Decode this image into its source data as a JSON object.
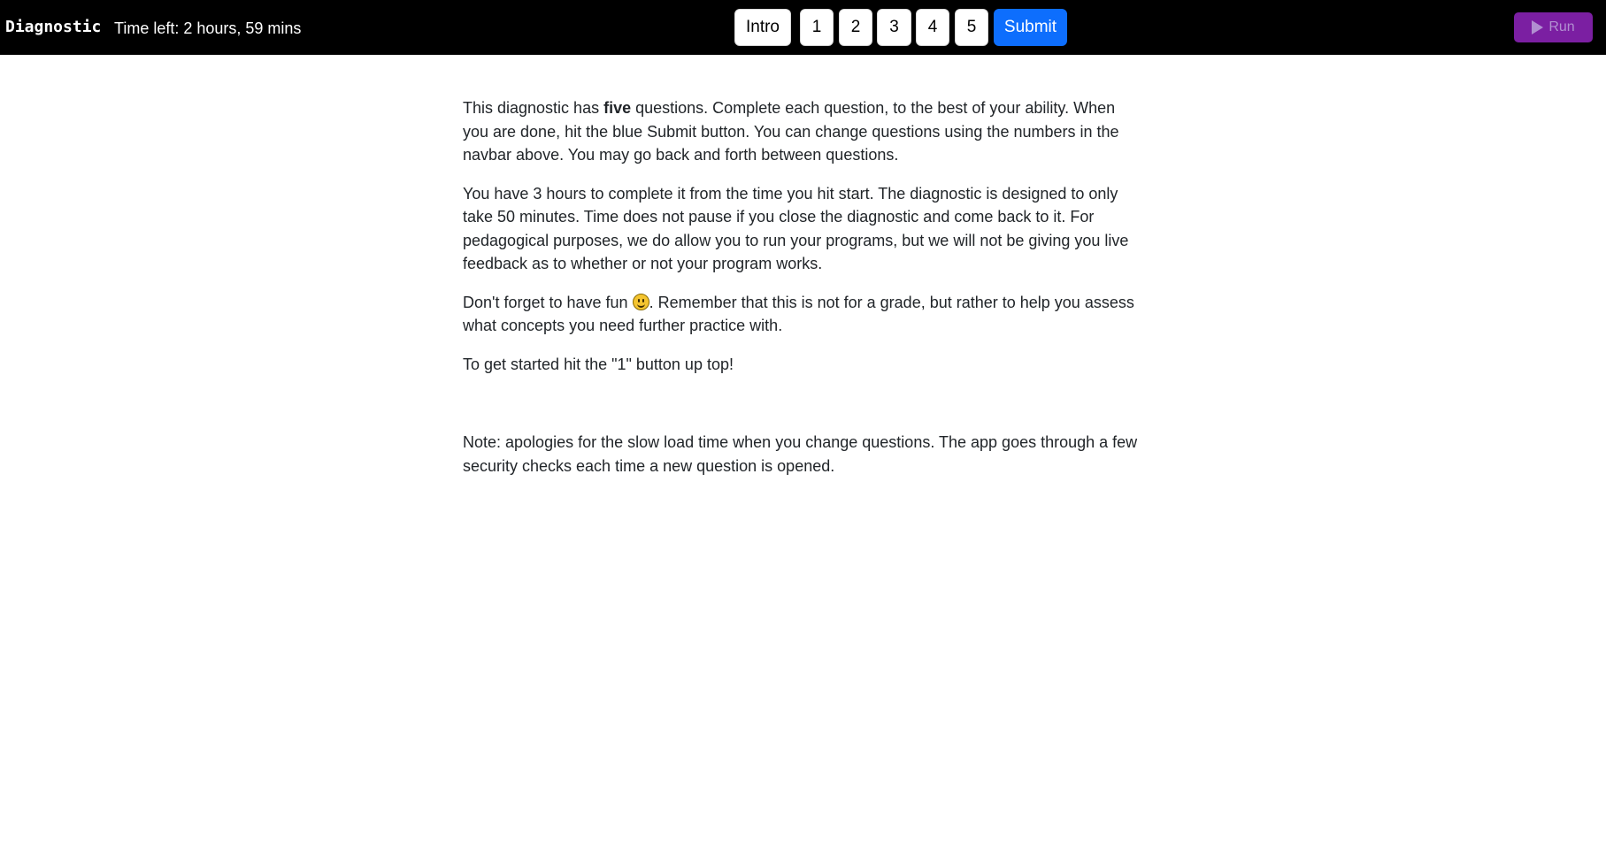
{
  "navbar": {
    "brand": "Diagnostic",
    "timer": "Time left: 2 hours, 59 mins",
    "intro_label": "Intro",
    "questions": [
      "1",
      "2",
      "3",
      "4",
      "5"
    ],
    "submit_label": "Submit",
    "run_label": "Run",
    "run_icon": "play-icon"
  },
  "content": {
    "p1_before": "This diagnostic has ",
    "p1_bold": "five",
    "p1_after": " questions. Complete each question, to the best of your ability. When you are done, hit the blue Submit button. You can change questions using the numbers in the navbar above. You may go back and forth between questions.",
    "p2": "You have 3 hours to complete it from the time you hit start. The diagnostic is designed to only take 50 minutes. Time does not pause if you close the diagnostic and come back to it. For pedagogical purposes, we do allow you to run your programs, but we will not be giving you live feedback as to whether or not your program works.",
    "p3_before": "Don't forget to have fun ",
    "p3_icon": "smiley-icon",
    "p3_after": ". Remember that this is not for a grade, but rather to help you assess what concepts you need further practice with.",
    "p4": "To get started hit the \"1\" button up top!",
    "note": "Note: apologies for the slow load time when you change questions. The app goes through a few security checks each time a new question is opened."
  },
  "colors": {
    "navbar_bg": "#000000",
    "submit_bg": "#0d6efd",
    "run_bg": "#7b1fa2",
    "run_text": "#b18fd1"
  }
}
